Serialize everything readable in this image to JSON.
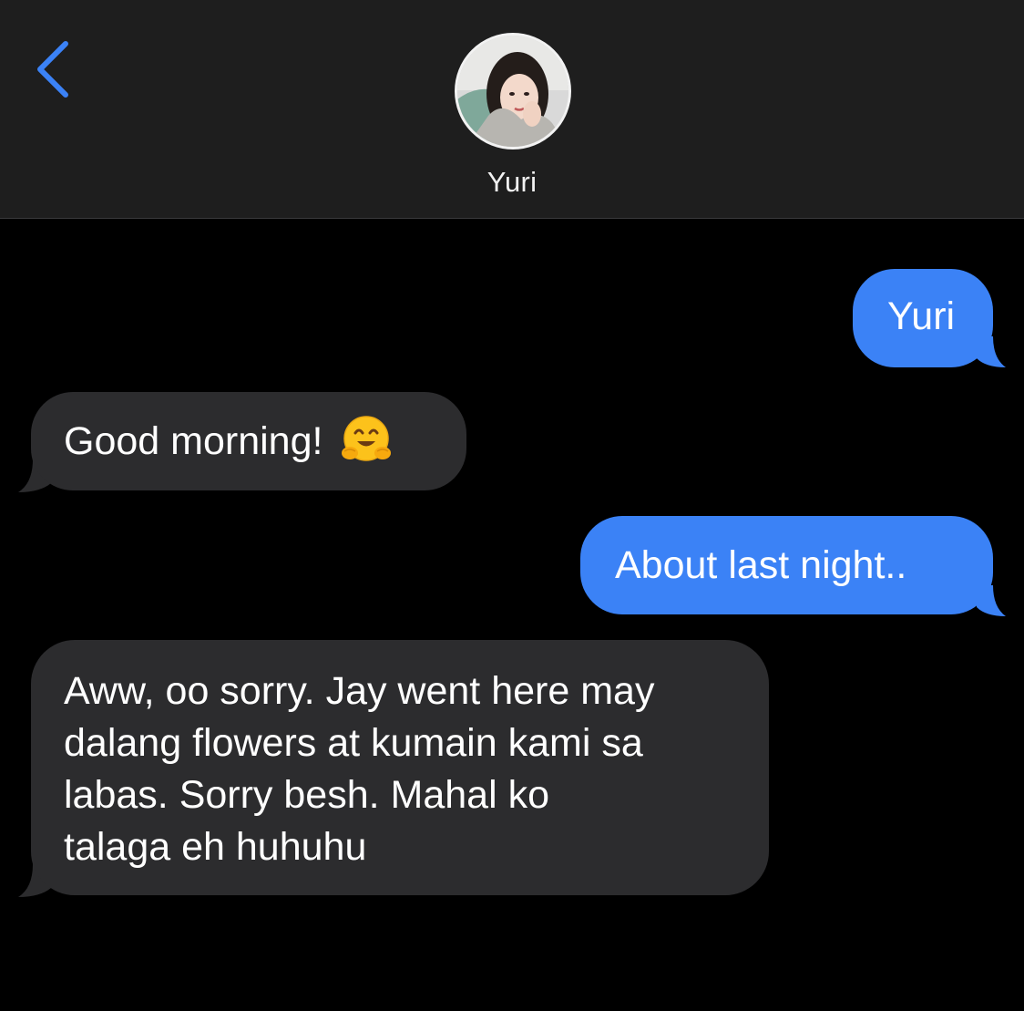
{
  "header": {
    "back_icon": "chevron-left-icon",
    "contact_name": "Yuri",
    "avatar_icon": "contact-photo",
    "accent_color": "#3b82f6"
  },
  "messages": [
    {
      "direction": "outgoing",
      "text": "Yuri"
    },
    {
      "direction": "incoming",
      "text": "Good morning!",
      "emoji": "hugging-face-emoji"
    },
    {
      "direction": "outgoing",
      "text": "About last night.."
    },
    {
      "direction": "incoming",
      "lines": [
        "Aww, oo sorry. Jay went here may",
        "dalang flowers at kumain kami sa",
        "labas. Sorry besh. Mahal ko",
        "talaga eh huhuhu"
      ]
    }
  ],
  "colors": {
    "outgoing_bubble": "#3b82f6",
    "incoming_bubble": "#2c2c2e",
    "header_bg": "#1e1e1e",
    "background": "#000000"
  }
}
